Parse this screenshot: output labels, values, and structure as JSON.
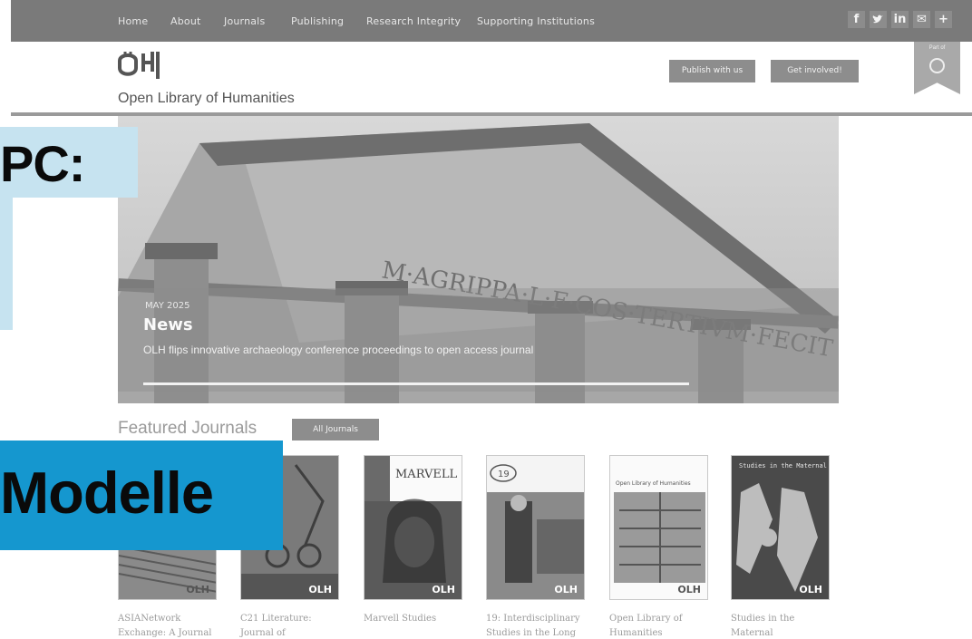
{
  "nav": {
    "links": [
      "Home",
      "About",
      "Journals",
      "Publishing",
      "Research Integrity",
      "Supporting Institutions"
    ],
    "social": [
      {
        "name": "facebook-icon",
        "glyph": "f"
      },
      {
        "name": "twitter-icon",
        "glyph": "🐦"
      },
      {
        "name": "linkedin-icon",
        "glyph": "in"
      },
      {
        "name": "email-icon",
        "glyph": "✉"
      },
      {
        "name": "plus-icon",
        "glyph": "+"
      }
    ]
  },
  "header": {
    "logo_text": "Open Library of Humanities",
    "publish_button": "Publish with us",
    "involved_button": "Get involved!",
    "ribbon_text": "Part of"
  },
  "hero": {
    "date": "MAY 2025",
    "title": "News",
    "text": "OLH flips innovative archaeology conference proceedings to open access journal",
    "inscription": "M·AGRIPPA·L·F·COS·TERTIVM·FECIT"
  },
  "featured": {
    "title": "Featured Journals",
    "all_button": "All Journals",
    "journals": [
      {
        "title": "ASIANetwork Exchange: A Journal",
        "cover_text": ""
      },
      {
        "title": "C21 Literature: Journal of",
        "cover_text": ""
      },
      {
        "title": "Marvell Studies",
        "cover_text": "MARVELL"
      },
      {
        "title": "19: Interdisciplinary Studies in the Long",
        "cover_text": "19"
      },
      {
        "title": "Open Library of Humanities",
        "cover_text": "Open Library of Humanities"
      },
      {
        "title": "Studies in the Maternal",
        "cover_text": "Studies in the Maternal"
      }
    ],
    "cover_logo": "OLH"
  },
  "overlay": {
    "top_label": "PC:",
    "bottom_label": "Modelle"
  },
  "colors": {
    "nav_bg": "#7a7a7a",
    "button_bg": "#8d8d8d",
    "overlay_light_blue": "#c6e3f0",
    "overlay_blue": "#1597cf"
  }
}
